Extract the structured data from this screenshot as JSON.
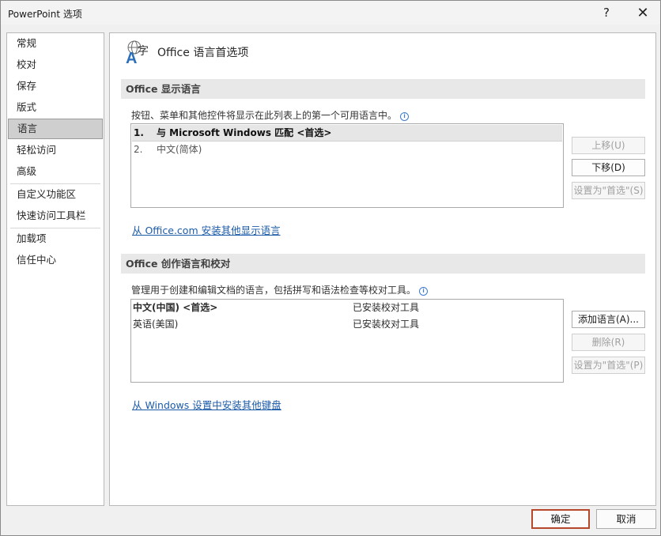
{
  "window": {
    "title": "PowerPoint 选项",
    "help_label": "?",
    "close_label": "✕"
  },
  "nav": {
    "items": [
      {
        "label": "常规"
      },
      {
        "label": "校对"
      },
      {
        "label": "保存"
      },
      {
        "label": "版式"
      },
      {
        "label": "语言",
        "selected": true
      },
      {
        "label": "轻松访问"
      },
      {
        "label": "高级"
      },
      {
        "label": "自定义功能区"
      },
      {
        "label": "快速访问工具栏"
      },
      {
        "label": "加载项"
      },
      {
        "label": "信任中心"
      }
    ]
  },
  "header": {
    "icon": "language-icon",
    "title": "Office 语言首选项"
  },
  "display_section": {
    "title": "Office 显示语言",
    "description": "按钮、菜单和其他控件将显示在此列表上的第一个可用语言中。",
    "info_glyph": "i",
    "languages": [
      {
        "num": "1.",
        "name": "与 Microsoft Windows 匹配 <首选>",
        "selected": true
      },
      {
        "num": "2.",
        "name": "中文(简体)"
      }
    ],
    "buttons": {
      "move_up": "上移(U)",
      "move_down": "下移(D)",
      "set_preferred": "设置为\"首选\"(S)"
    },
    "link": "从 Office.com 安装其他显示语言"
  },
  "authoring_section": {
    "title": "Office 创作语言和校对",
    "description": "管理用于创建和编辑文档的语言，包括拼写和语法检查等校对工具。",
    "info_glyph": "i",
    "languages": [
      {
        "name": "中文(中国) <首选>",
        "status": "已安装校对工具",
        "bold": true
      },
      {
        "name": "英语(美国)",
        "status": "已安装校对工具"
      }
    ],
    "buttons": {
      "add": "添加语言(A)...",
      "remove": "删除(R)",
      "set_preferred": "设置为\"首选\"(P)"
    },
    "link": "从 Windows 设置中安装其他键盘"
  },
  "footer": {
    "ok": "确定",
    "cancel": "取消"
  },
  "colors": {
    "accent_border": "#b7472a",
    "link": "#1c5ba8",
    "info": "#3d7bd1"
  }
}
